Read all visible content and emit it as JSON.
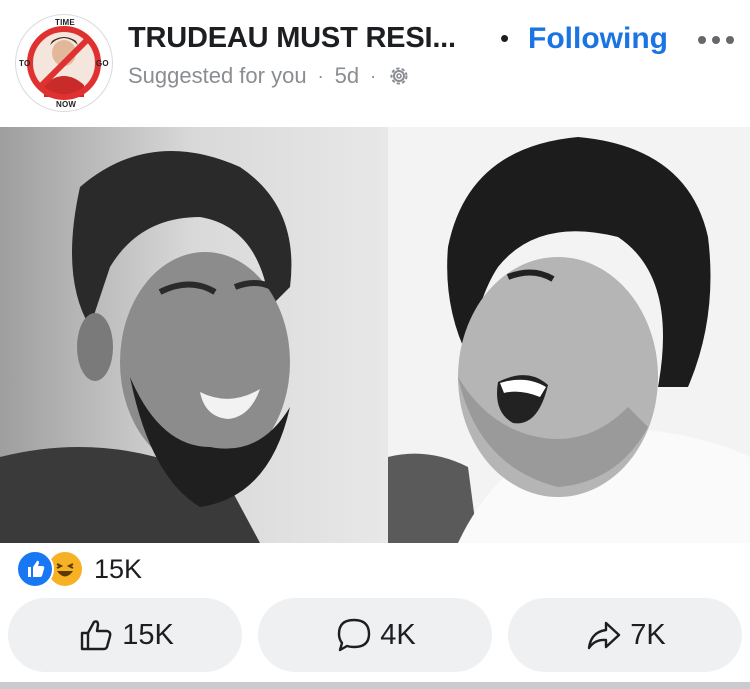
{
  "post": {
    "page_name": "TRUDEAU MUST RESI...",
    "follow_label": "Following",
    "meta": {
      "suggested": "Suggested for you",
      "age": "5d"
    },
    "avatar_text": {
      "top": "TIME",
      "bottom": "NOW",
      "left": "TO",
      "right": "GO"
    },
    "images": [
      {
        "name": "left-portrait",
        "tone": "grayscale"
      },
      {
        "name": "right-portrait",
        "tone": "grayscale"
      }
    ]
  },
  "reactions": {
    "types": [
      "like",
      "haha"
    ],
    "count": "15K"
  },
  "actions": {
    "like": "15K",
    "comment": "4K",
    "share": "7K"
  },
  "colors": {
    "accent": "#1b74e4",
    "like_blue": "#1877f2",
    "haha_yellow": "#f7b125",
    "button_bg": "#eff0f2",
    "muted_text": "#8a8d91"
  },
  "icons": [
    "more-icon",
    "gear-icon",
    "like-reaction-icon",
    "haha-reaction-icon",
    "thumbs-up-icon",
    "comment-icon",
    "share-icon"
  ]
}
